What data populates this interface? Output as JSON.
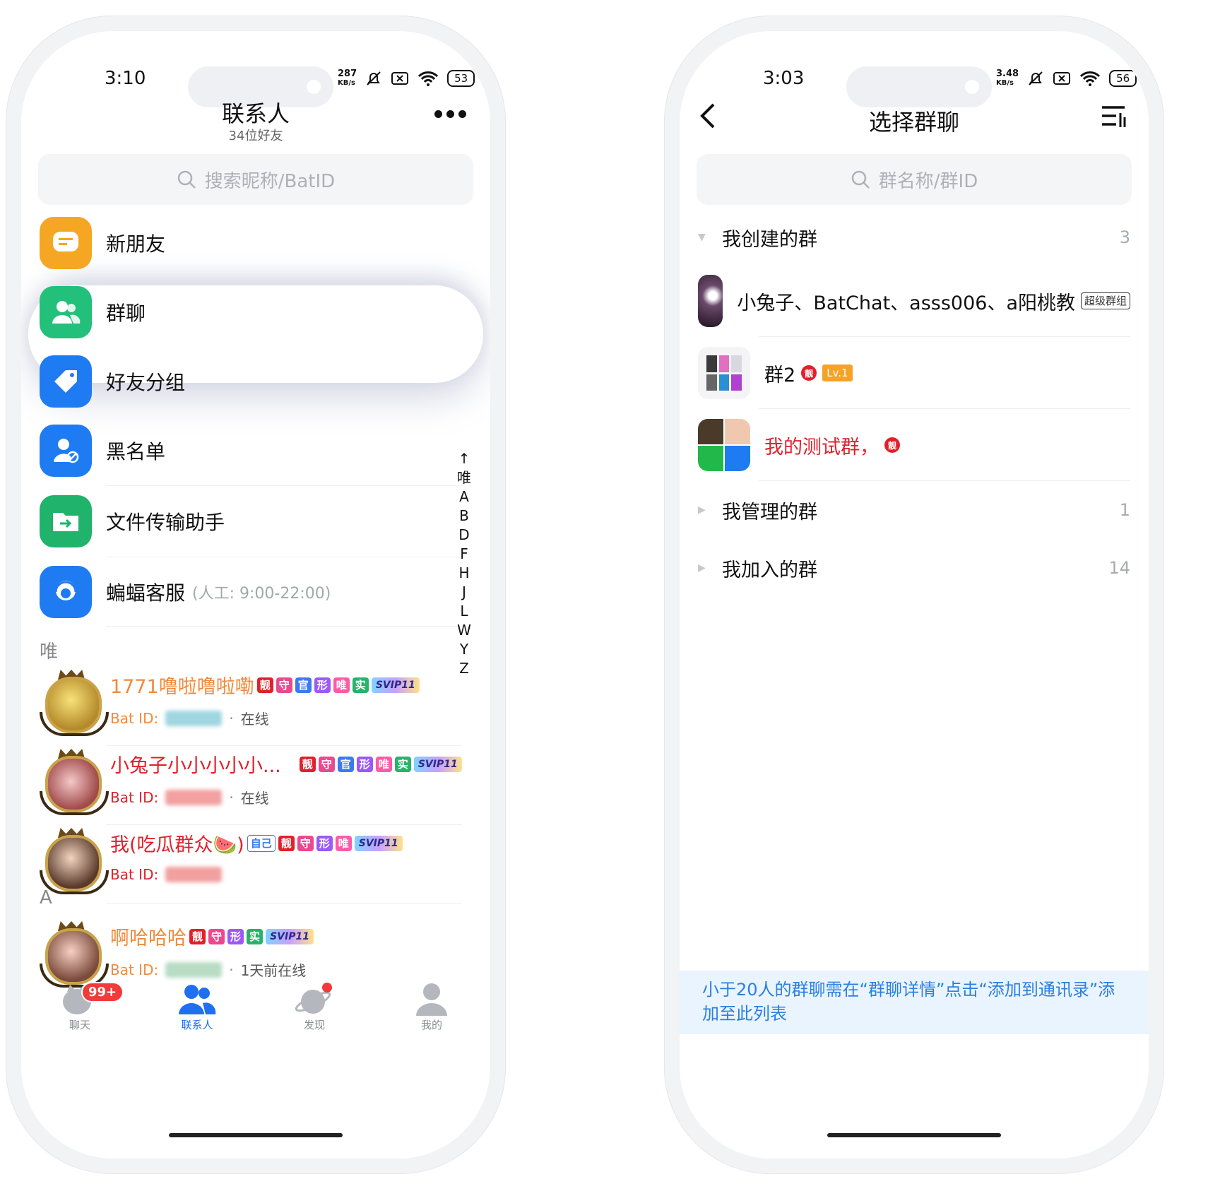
{
  "left": {
    "status": {
      "time": "3:10",
      "speed_value": "287",
      "speed_unit": "KB/s",
      "battery": "53"
    },
    "header": {
      "title": "联系人",
      "subtitle": "34位好友",
      "more_icon": "more-dots-icon"
    },
    "search": {
      "placeholder": "搜索昵称/BatID"
    },
    "menu": [
      {
        "label": "新朋友",
        "icon": "chat-bubble-icon",
        "color": "#f5a623"
      },
      {
        "label": "群聊",
        "icon": "users-icon",
        "color": "#22c07a"
      },
      {
        "label": "好友分组",
        "icon": "tag-icon",
        "color": "#1f7bf2"
      },
      {
        "label": "黑名单",
        "icon": "user-block-icon",
        "color": "#1f7bf2"
      },
      {
        "label": "文件传输助手",
        "icon": "folder-transfer-icon",
        "color": "#1fb36b"
      },
      {
        "label": "蝙蝠客服",
        "sub": "(人工: 9:00-22:00)",
        "icon": "support-agent-icon",
        "color": "#1f7bf2"
      }
    ],
    "sections": [
      {
        "letter": "唯",
        "contacts": [
          {
            "name": "1771噜啦噜啦嘞",
            "name_color": "#f08a3c",
            "badges": [
              "靓",
              "守",
              "官",
              "形",
              "唯",
              "实"
            ],
            "svip": "SVIP11",
            "id_label": "Bat ID:",
            "status": "在线"
          },
          {
            "name": "小兔子小小小小小...",
            "name_color": "#e0202a",
            "badges": [
              "靓",
              "守",
              "官",
              "形",
              "唯",
              "实"
            ],
            "svip": "SVIP11",
            "id_label": "Bat ID:",
            "status": "在线"
          },
          {
            "name": "我(吃瓜群众🍉)",
            "name_color": "#e0202a",
            "self_tag": "自己",
            "badges": [
              "靓",
              "守",
              "形",
              "唯"
            ],
            "svip": "SVIP11",
            "id_label": "Bat ID:",
            "status": ""
          }
        ]
      },
      {
        "letter": "A",
        "contacts": [
          {
            "name": "啊哈哈哈",
            "name_color": "#f08a3c",
            "badges": [
              "靓",
              "守",
              "形",
              "实"
            ],
            "svip": "SVIP11",
            "id_label": "Bat ID:",
            "status": "1天前在线"
          }
        ]
      }
    ],
    "index": [
      "↑",
      "唯",
      "A",
      "B",
      "D",
      "F",
      "H",
      "J",
      "L",
      "W",
      "Y",
      "Z"
    ],
    "tabs": [
      {
        "label": "聊天",
        "icon": "chat-cat-icon",
        "badge": "99+"
      },
      {
        "label": "联系人",
        "icon": "contacts-icon",
        "active": true
      },
      {
        "label": "发现",
        "icon": "planet-icon"
      },
      {
        "label": "我的",
        "icon": "profile-icon"
      }
    ],
    "badge_colors": {
      "靓": "#e0202a",
      "守": "#e9498f",
      "官": "#3b7bf0",
      "形": "#9b59f5",
      "唯": "#ff5aa8",
      "实": "#27b36a"
    }
  },
  "right": {
    "status": {
      "time": "3:03",
      "speed_value": "3.48",
      "speed_unit": "KB/s",
      "battery": "56"
    },
    "header": {
      "title": "选择群聊",
      "back_icon": "back-arrow-icon",
      "sort_icon": "sort-list-icon"
    },
    "search": {
      "placeholder": "群名称/群ID"
    },
    "created": {
      "title": "我创建的群",
      "count": "3"
    },
    "groups": [
      {
        "name": "小兔子、BatChat、asss006、a阳桃教",
        "tag": "超级群组"
      },
      {
        "name": "群2",
        "liang": "靓",
        "lv": "Lv.1"
      },
      {
        "name": "我的测试群，",
        "liang": "靓",
        "name_color": "#e0202a"
      }
    ],
    "managed": {
      "title": "我管理的群",
      "count": "1"
    },
    "joined": {
      "title": "我加入的群",
      "count": "14"
    },
    "notice": "小于20人的群聊需在“群聊详情”点击“添加到通讯录”添加至此列表"
  }
}
